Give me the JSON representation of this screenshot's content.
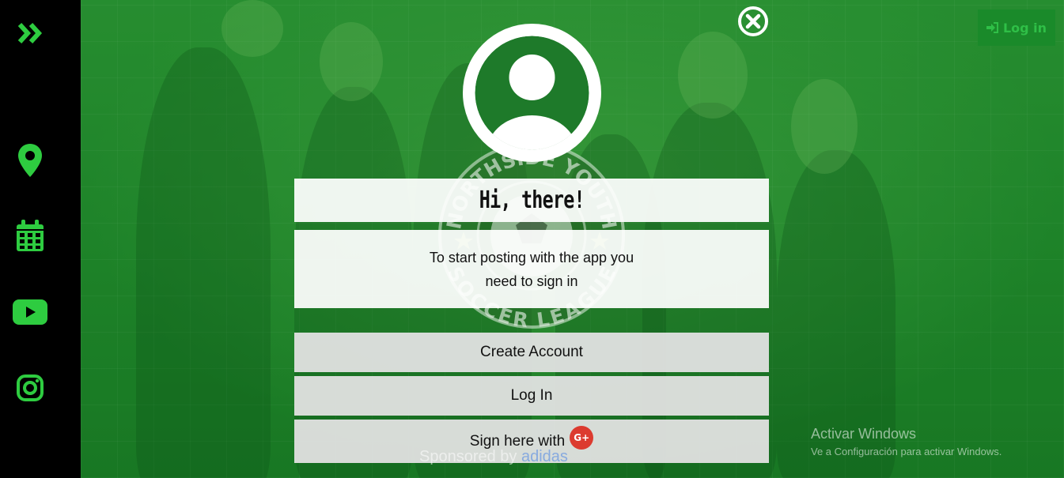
{
  "header": {
    "login_label": "Log in"
  },
  "modal": {
    "title": "Hi, there!",
    "message": "To start posting with the app you need to sign in",
    "create_account_label": "Create Account",
    "login_label": "Log In",
    "google_label": "Sign here with",
    "google_badge": "G+"
  },
  "badge": {
    "top_text": "NORTHSIDE YOUTH",
    "bottom_text": "SOCCER LEAGUE"
  },
  "footer": {
    "sponsored_prefix": "Sponsored by",
    "sponsor_name": "adidas"
  },
  "windows_notice": {
    "title": "Activar Windows",
    "subtitle": "Ve a Configuración para activar Windows."
  },
  "sidebar": {
    "items": [
      {
        "icon": "double-chevron-right-icon"
      },
      {
        "icon": "map-pin-icon"
      },
      {
        "icon": "calendar-icon"
      },
      {
        "icon": "youtube-icon"
      },
      {
        "icon": "instagram-icon"
      }
    ]
  },
  "colors": {
    "accent": "#2ecc40",
    "sidebar_bg": "#000000",
    "google_red": "#dc3b2f"
  }
}
